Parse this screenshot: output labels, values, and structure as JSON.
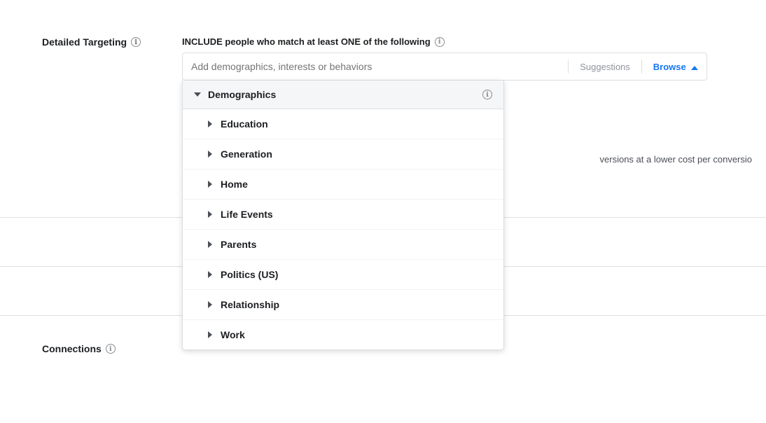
{
  "page": {
    "background": "#fff"
  },
  "targeting": {
    "section_label": "Detailed Targeting",
    "info_icon": "ℹ",
    "include_text": "INCLUDE people who match at least ONE of the following",
    "include_info": "ℹ",
    "search_placeholder": "Add demographics, interests or behaviors",
    "suggestions_label": "Suggestions",
    "browse_label": "Browse"
  },
  "dropdown": {
    "header": {
      "label": "Demographics",
      "info": "ℹ"
    },
    "items": [
      {
        "id": "education",
        "label": "Education"
      },
      {
        "id": "generation",
        "label": "Generation"
      },
      {
        "id": "home",
        "label": "Home"
      },
      {
        "id": "life-events",
        "label": "Life Events"
      },
      {
        "id": "parents",
        "label": "Parents"
      },
      {
        "id": "politics",
        "label": "Politics (US)"
      },
      {
        "id": "relationship",
        "label": "Relationship"
      },
      {
        "id": "work",
        "label": "Work"
      }
    ]
  },
  "connections": {
    "label": "Connections",
    "info": "ℹ"
  },
  "right_text": "versions at a lower cost per conversio"
}
